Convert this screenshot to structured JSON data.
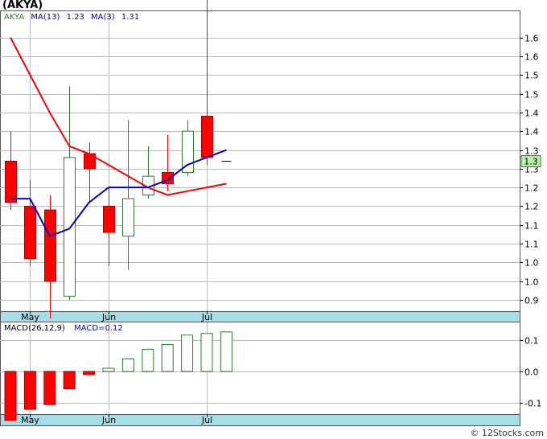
{
  "header": {
    "title": "(AKYA)"
  },
  "footer": {
    "credit": "© 12Stocks.com"
  },
  "colors": {
    "up": "#2e7d32",
    "down": "#ff0000",
    "ma13": "#ff0000",
    "ma3": "#0000cc",
    "axis_band": "#a8dce6",
    "badge": "#b8f0b0"
  },
  "chart_data": [
    {
      "type": "candlestick",
      "legend": {
        "ticker": "AKYA",
        "ma13_label": "MA(13)",
        "ma13_value": "1.23",
        "ma3_label": "MA(3)",
        "ma3_value": "1.31"
      },
      "x_labels": [
        "May",
        "Jun",
        "Jul"
      ],
      "x_label_at": [
        1,
        5,
        10
      ],
      "y_ticks": [
        {
          "v": 1.6,
          "label": "1.6"
        },
        {
          "v": 1.55,
          "label": "1.6"
        },
        {
          "v": 1.5,
          "label": "1.5"
        },
        {
          "v": 1.45,
          "label": "1.5"
        },
        {
          "v": 1.4,
          "label": "1.4"
        },
        {
          "v": 1.35,
          "label": "1.4"
        },
        {
          "v": 1.3,
          "label": "1.3"
        },
        {
          "v": 1.25,
          "label": "1.3"
        },
        {
          "v": 1.2,
          "label": "1.2"
        },
        {
          "v": 1.15,
          "label": "1.2"
        },
        {
          "v": 1.1,
          "label": "1.1"
        },
        {
          "v": 1.05,
          "label": "1.1"
        },
        {
          "v": 1.0,
          "label": "1.0"
        },
        {
          "v": 0.95,
          "label": "1.0"
        },
        {
          "v": 0.9,
          "label": "0.9"
        }
      ],
      "ylim": [
        0.87,
        1.67
      ],
      "last_price_label": "1.3",
      "last_price": 1.27,
      "candles": [
        {
          "o": 1.27,
          "h": 1.35,
          "l": 1.14,
          "c": 1.16
        },
        {
          "o": 1.15,
          "h": 1.22,
          "l": 0.99,
          "c": 1.01
        },
        {
          "o": 1.14,
          "h": 1.18,
          "l": 0.85,
          "c": 0.95
        },
        {
          "o": 0.91,
          "h": 1.47,
          "l": 0.9,
          "c": 1.28
        },
        {
          "o": 1.29,
          "h": 1.32,
          "l": 1.16,
          "c": 1.25
        },
        {
          "o": 1.15,
          "h": 1.2,
          "l": 0.99,
          "c": 1.08
        },
        {
          "o": 1.07,
          "h": 1.38,
          "l": 0.98,
          "c": 1.17
        },
        {
          "o": 1.18,
          "h": 1.31,
          "l": 1.17,
          "c": 1.23
        },
        {
          "o": 1.24,
          "h": 1.34,
          "l": 1.19,
          "c": 1.21
        },
        {
          "o": 1.24,
          "h": 1.38,
          "l": 1.23,
          "c": 1.35
        },
        {
          "o": 1.39,
          "h": 1.7,
          "l": 1.26,
          "c": 1.28
        },
        {
          "o": 1.27,
          "h": 1.27,
          "l": 1.27,
          "c": 1.27
        }
      ],
      "ma13": [
        1.6,
        1.5,
        1.4,
        1.31,
        1.29,
        1.26,
        1.23,
        1.2,
        1.18,
        null,
        null,
        null
      ],
      "ma13_tail": [
        1.19,
        1.2,
        1.21
      ],
      "ma3": [
        1.17,
        1.17,
        1.07,
        1.09,
        1.16,
        1.2,
        1.2,
        1.2,
        1.22,
        1.26,
        1.28,
        1.3
      ]
    },
    {
      "type": "bar",
      "legend": {
        "label": "MACD(26,12,9)",
        "value_label": "MACD=0.12"
      },
      "y_ticks": [
        {
          "v": 0.1,
          "label": "0.1"
        },
        {
          "v": 0.0,
          "label": "0.0"
        },
        {
          "v": -0.1,
          "label": "-0.1"
        }
      ],
      "ylim": [
        -0.135,
        0.155
      ],
      "values": [
        -0.155,
        -0.12,
        -0.105,
        -0.055,
        -0.01,
        0.01,
        0.04,
        0.07,
        0.085,
        0.115,
        0.12,
        0.125
      ]
    }
  ]
}
